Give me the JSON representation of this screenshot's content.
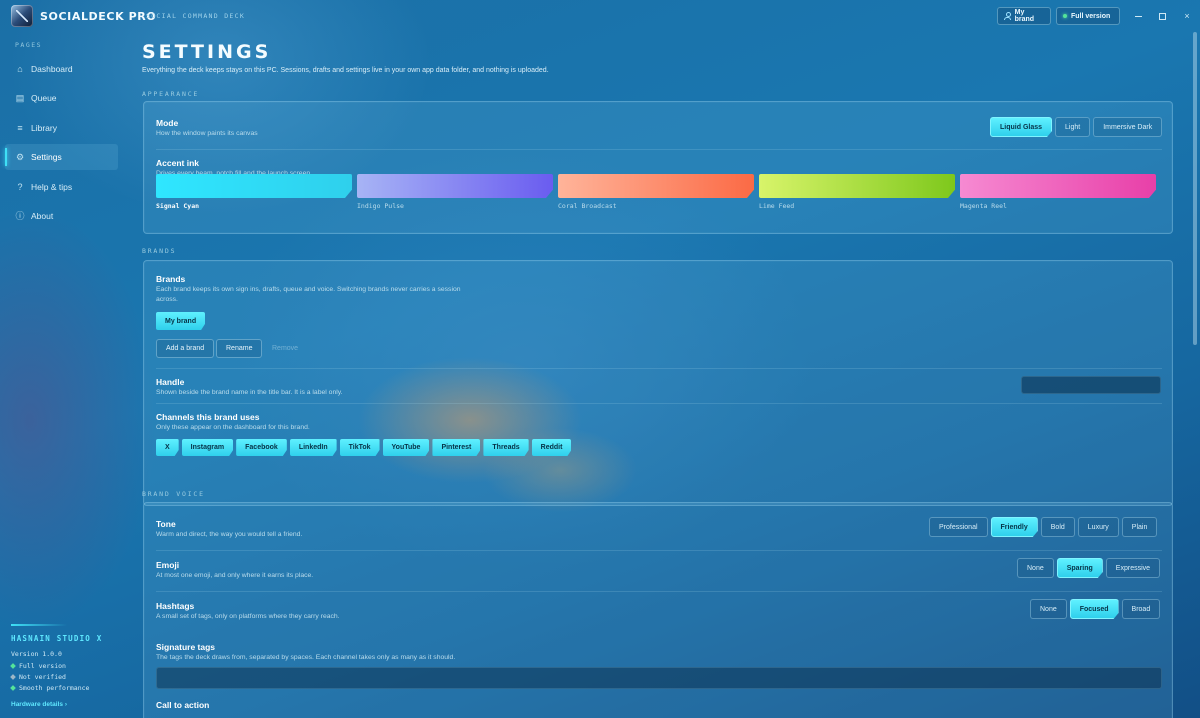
{
  "app": {
    "title": "SOCIALDECK PRO",
    "subtitle": "SOCIAL COMMAND DECK",
    "brand_button": "My brand",
    "version_button": "Full version",
    "accent": "#3fe0f6"
  },
  "window_controls": {
    "minimize": "minimize-icon",
    "maximize": "maximize-icon",
    "close": "×"
  },
  "sidebar": {
    "heading": "PAGES",
    "items": [
      {
        "label": "Dashboard",
        "icon": "⌂"
      },
      {
        "label": "Queue",
        "icon": "▤"
      },
      {
        "label": "Library",
        "icon": "≡"
      },
      {
        "label": "Settings",
        "icon": "⚙",
        "active": true
      },
      {
        "label": "Help & tips",
        "icon": "?"
      },
      {
        "label": "About",
        "icon": "ⓘ"
      }
    ],
    "studio": {
      "name": "HASNAIN STUDIO X",
      "version": "Version 1.0.0",
      "statuses": [
        {
          "label": "Full version",
          "on": true
        },
        {
          "label": "Not verified",
          "on": false
        },
        {
          "label": "Smooth performance",
          "on": true
        }
      ],
      "hardware_link": "Hardware details ›"
    }
  },
  "page": {
    "title": "SETTINGS",
    "subtitle": "Everything the deck keeps stays on this PC. Sessions, drafts and settings live in your own app data folder, and nothing is uploaded."
  },
  "appearance": {
    "section": "APPEARANCE",
    "mode": {
      "title": "Mode",
      "desc": "How the window paints its canvas",
      "options": [
        "Liquid Glass",
        "Light",
        "Immersive Dark"
      ],
      "selected": "Liquid Glass"
    },
    "accent": {
      "title": "Accent ink",
      "desc": "Drives every beam, notch fill and the launch screen",
      "swatches": [
        {
          "name": "Signal Cyan",
          "from": "#2fe6ff",
          "to": "#2fd0ec",
          "selected": true
        },
        {
          "name": "Indigo Pulse",
          "from": "#a7b4f5",
          "to": "#6a5cf0",
          "selected": false
        },
        {
          "name": "Coral Broadcast",
          "from": "#ffb49a",
          "to": "#fb6a45",
          "selected": false
        },
        {
          "name": "Lime Feed",
          "from": "#d8f46a",
          "to": "#7ec81c",
          "selected": false
        },
        {
          "name": "Magenta Reel",
          "from": "#f68ad2",
          "to": "#e83fa8",
          "selected": false
        }
      ]
    }
  },
  "brands": {
    "section": "BRANDS",
    "title": "Brands",
    "desc": "Each brand keeps its own sign ins, drafts, queue and voice. Switching brands never carries a session across.",
    "current": "My brand",
    "add_label": "Add a brand",
    "rename_label": "Rename",
    "remove_label": "Remove",
    "handle": {
      "title": "Handle",
      "desc": "Shown beside the brand name in the title bar. It is a label only.",
      "value": ""
    },
    "channels": {
      "title": "Channels this brand uses",
      "desc": "Only these appear on the dashboard for this brand.",
      "items": [
        "X",
        "Instagram",
        "Facebook",
        "LinkedIn",
        "TikTok",
        "YouTube",
        "Pinterest",
        "Threads",
        "Reddit"
      ]
    }
  },
  "voice": {
    "section": "BRAND VOICE",
    "tone": {
      "title": "Tone",
      "desc": "Warm and direct, the way you would tell a friend.",
      "options": [
        "Professional",
        "Friendly",
        "Bold",
        "Luxury",
        "Plain"
      ],
      "selected": "Friendly"
    },
    "emoji": {
      "title": "Emoji",
      "desc": "At most one emoji, and only where it earns its place.",
      "options": [
        "None",
        "Sparing",
        "Expressive"
      ],
      "selected": "Sparing"
    },
    "hashtags": {
      "title": "Hashtags",
      "desc": "A small set of tags, only on platforms where they carry reach.",
      "options": [
        "None",
        "Focused",
        "Broad"
      ],
      "selected": "Focused"
    },
    "signature": {
      "title": "Signature tags",
      "desc": "The tags the deck draws from, separated by spaces. Each channel takes only as many as it should.",
      "value": ""
    },
    "cta": {
      "title": "Call to action"
    }
  }
}
